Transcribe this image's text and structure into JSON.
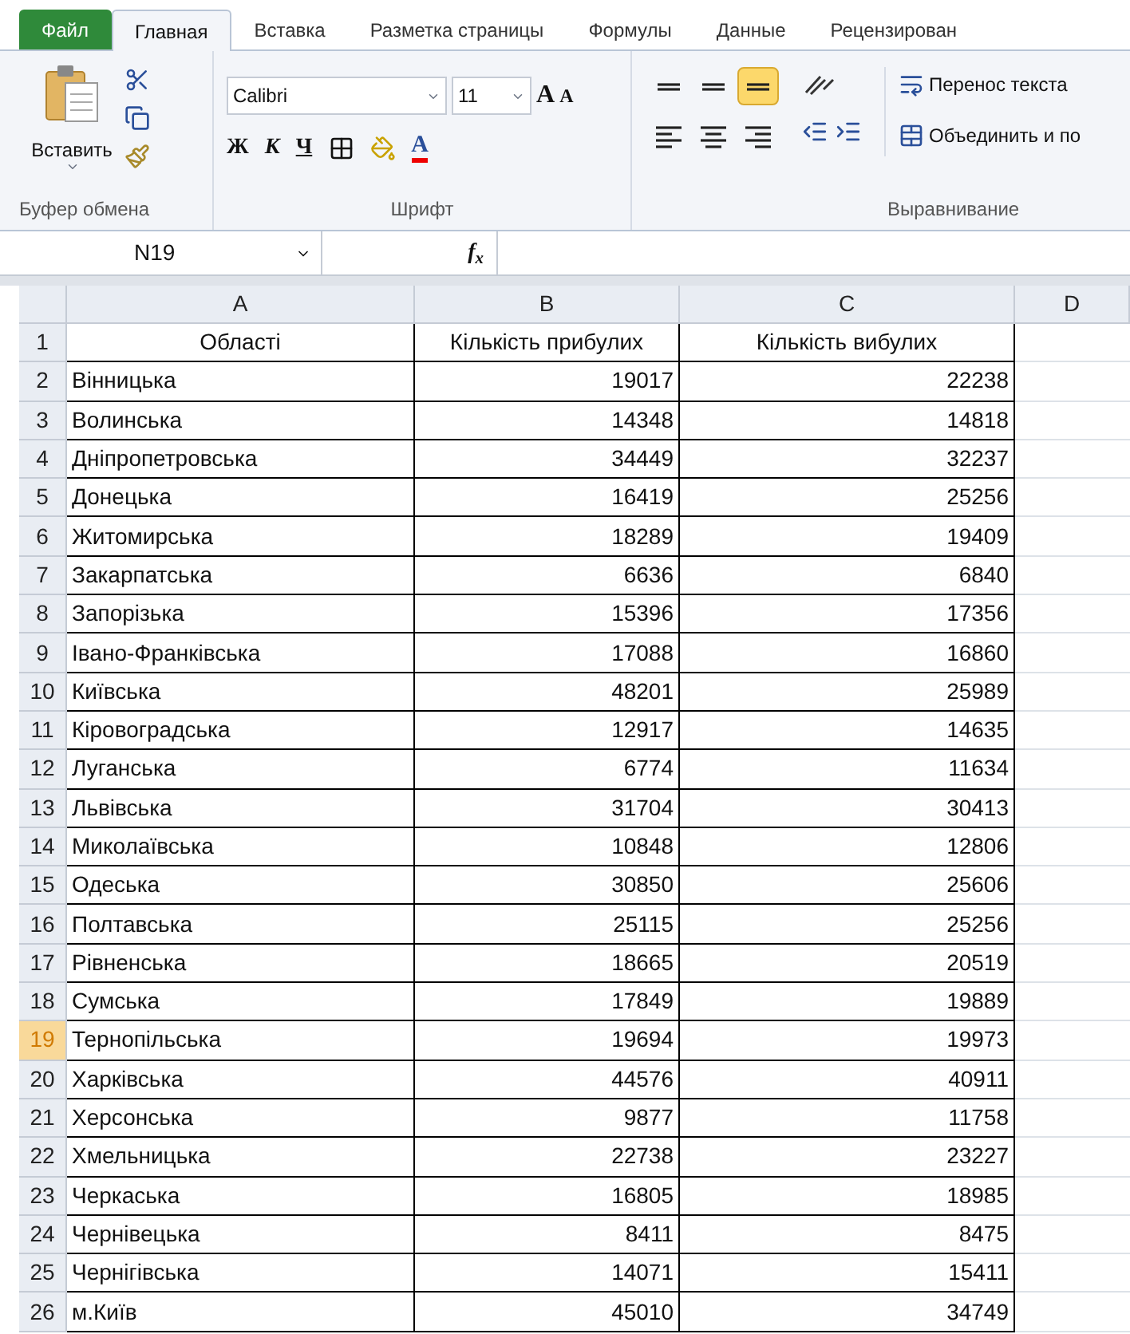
{
  "tabs": [
    {
      "label": "Файл",
      "kind": "file",
      "selected": false
    },
    {
      "label": "Главная",
      "kind": "normal",
      "selected": true
    },
    {
      "label": "Вставка",
      "kind": "normal",
      "selected": false
    },
    {
      "label": "Разметка страницы",
      "kind": "normal",
      "selected": false
    },
    {
      "label": "Формулы",
      "kind": "normal",
      "selected": false
    },
    {
      "label": "Данные",
      "kind": "normal",
      "selected": false
    },
    {
      "label": "Рецензирован",
      "kind": "normal",
      "selected": false
    }
  ],
  "ribbon": {
    "clipboard": {
      "paste_label": "Вставить",
      "group_label": "Буфер обмена"
    },
    "font": {
      "font_name": "Calibri",
      "font_size": "11",
      "grow_label": "A",
      "shrink_label": "A",
      "bold": "Ж",
      "italic": "К",
      "underline": "Ч",
      "color_label": "A",
      "group_label": "Шрифт"
    },
    "alignment": {
      "align_buttons": [
        {
          "kind": "top",
          "selected": false
        },
        {
          "kind": "middle",
          "selected": false
        },
        {
          "kind": "bottom",
          "selected": true
        },
        {
          "kind": "left",
          "selected": false
        },
        {
          "kind": "center",
          "selected": false
        },
        {
          "kind": "right",
          "selected": false
        }
      ],
      "wrap_label": "Перенос текста",
      "merge_label": "Объединить и по",
      "group_label": "Выравнивание"
    }
  },
  "formula_bar": {
    "name_box": "N19",
    "fx": "f$_{x}$"
  },
  "sheet": {
    "columns": [
      {
        "label": "A",
        "selected": false
      },
      {
        "label": "B",
        "selected": false
      },
      {
        "label": "C",
        "selected": false
      },
      {
        "label": "D",
        "selected": false
      }
    ],
    "header": {
      "number": "1",
      "selected": false,
      "cells": [
        "Області",
        "Кількість прибулих",
        "Кількість вибулих"
      ]
    },
    "rows": [
      {
        "number": "2",
        "selected": false,
        "region": "Вінницька",
        "arrived": "19017",
        "departed": "22238"
      },
      {
        "number": "3",
        "selected": false,
        "region": "Волинська",
        "arrived": "14348",
        "departed": "14818"
      },
      {
        "number": "4",
        "selected": false,
        "region": "Дніпропетровська",
        "arrived": "34449",
        "departed": "32237"
      },
      {
        "number": "5",
        "selected": false,
        "region": "Донецька",
        "arrived": "16419",
        "departed": "25256"
      },
      {
        "number": "6",
        "selected": false,
        "region": "Житомирська",
        "arrived": "18289",
        "departed": "19409"
      },
      {
        "number": "7",
        "selected": false,
        "region": "Закарпатська",
        "arrived": "6636",
        "departed": "6840"
      },
      {
        "number": "8",
        "selected": false,
        "region": "Запорізька",
        "arrived": "15396",
        "departed": "17356"
      },
      {
        "number": "9",
        "selected": false,
        "region": "Івано-Франківська",
        "arrived": "17088",
        "departed": "16860"
      },
      {
        "number": "10",
        "selected": false,
        "region": "Київська",
        "arrived": "48201",
        "departed": "25989"
      },
      {
        "number": "11",
        "selected": false,
        "region": "Кіровоградська",
        "arrived": "12917",
        "departed": "14635"
      },
      {
        "number": "12",
        "selected": false,
        "region": "Луганська",
        "arrived": "6774",
        "departed": "11634"
      },
      {
        "number": "13",
        "selected": false,
        "region": "Львівська",
        "arrived": "31704",
        "departed": "30413"
      },
      {
        "number": "14",
        "selected": false,
        "region": "Миколаївська",
        "arrived": "10848",
        "departed": "12806"
      },
      {
        "number": "15",
        "selected": false,
        "region": "Одеська",
        "arrived": "30850",
        "departed": "25606"
      },
      {
        "number": "16",
        "selected": false,
        "region": "Полтавська",
        "arrived": "25115",
        "departed": "25256"
      },
      {
        "number": "17",
        "selected": false,
        "region": "Рівненська",
        "arrived": "18665",
        "departed": "20519"
      },
      {
        "number": "18",
        "selected": false,
        "region": "Сумська",
        "arrived": "17849",
        "departed": "19889"
      },
      {
        "number": "19",
        "selected": true,
        "region": "Тернопільська",
        "arrived": "19694",
        "departed": "19973"
      },
      {
        "number": "20",
        "selected": false,
        "region": "Харківська",
        "arrived": "44576",
        "departed": "40911"
      },
      {
        "number": "21",
        "selected": false,
        "region": "Херсонська",
        "arrived": "9877",
        "departed": "11758"
      },
      {
        "number": "22",
        "selected": false,
        "region": "Хмельницька",
        "arrived": "22738",
        "departed": "23227"
      },
      {
        "number": "23",
        "selected": false,
        "region": "Черкаська",
        "arrived": "16805",
        "departed": "18985"
      },
      {
        "number": "24",
        "selected": false,
        "region": "Чернівецька",
        "arrived": "8411",
        "departed": "8475"
      },
      {
        "number": "25",
        "selected": false,
        "region": "Чернігівська",
        "arrived": "14071",
        "departed": "15411"
      },
      {
        "number": "26",
        "selected": false,
        "region": "м.Київ",
        "arrived": "45010",
        "departed": "34749"
      }
    ]
  }
}
